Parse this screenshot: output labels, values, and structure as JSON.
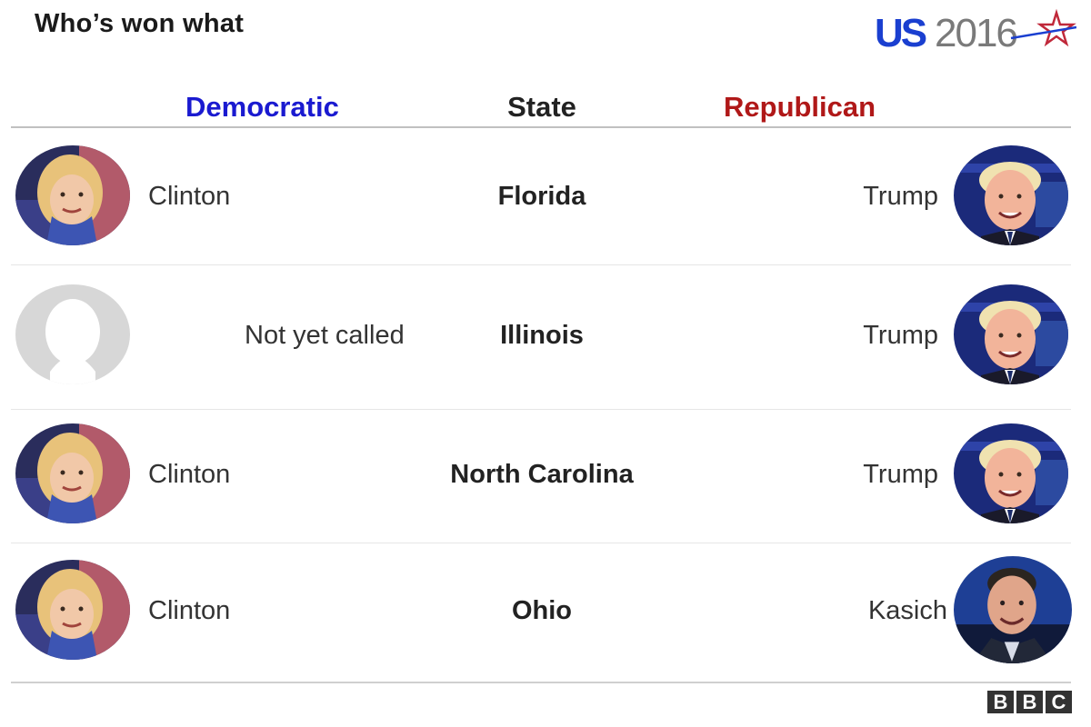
{
  "title": "Who’s won what",
  "logo": {
    "us": "US",
    "year": "2016"
  },
  "columns": {
    "democratic": "Democratic",
    "state": "State",
    "republican": "Republican"
  },
  "colors": {
    "democratic": "#1a1ad0",
    "republican": "#b01818",
    "rule": "#c0c0c0"
  },
  "rows": [
    {
      "state": "Florida",
      "democratic": "Clinton",
      "republican": "Trump"
    },
    {
      "state": "Illinois",
      "democratic": "Not yet called",
      "republican": "Trump"
    },
    {
      "state": "North Carolina",
      "democratic": "Clinton",
      "republican": "Trump"
    },
    {
      "state": "Ohio",
      "democratic": "Clinton",
      "republican": "Kasich"
    }
  ],
  "footer": {
    "brand": [
      "B",
      "B",
      "C"
    ]
  }
}
